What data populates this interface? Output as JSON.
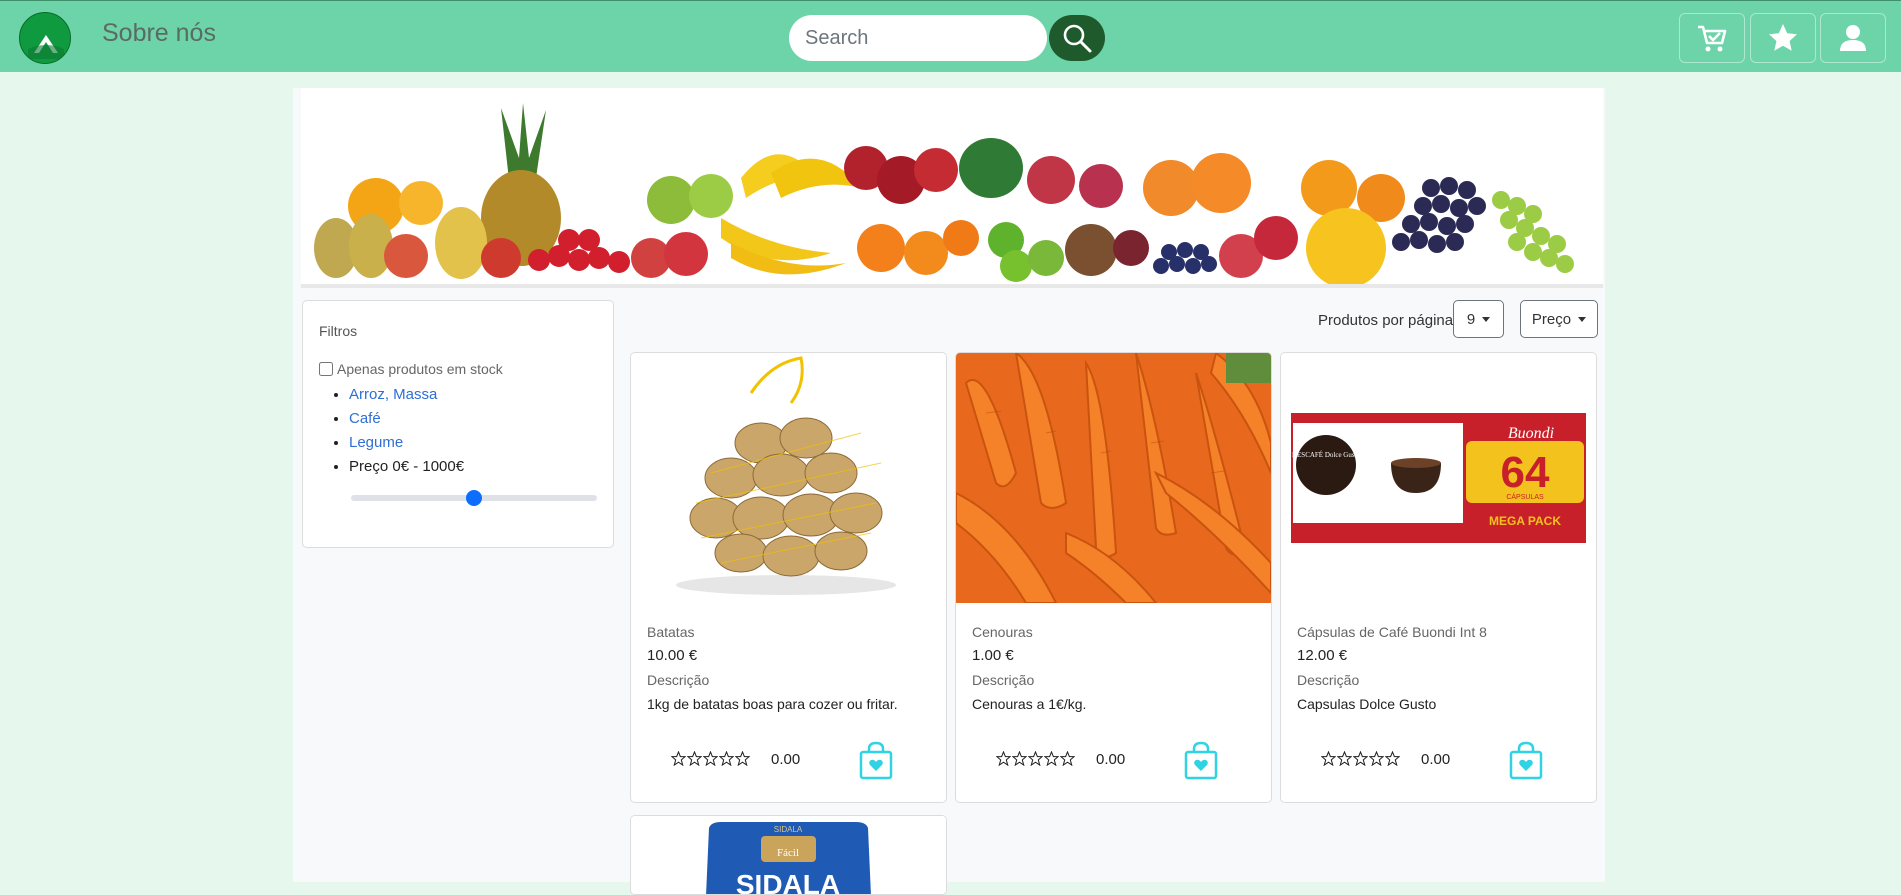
{
  "nav": {
    "about_label": "Sobre nós",
    "search_placeholder": "Search"
  },
  "filters": {
    "title": "Filtros",
    "stock_label": "Apenas produtos em stock",
    "categories": [
      "Arroz, Massa",
      "Café",
      "Legume"
    ],
    "price_label": "Preço 0€ - 1000€",
    "price_slider_fraction": 0.5
  },
  "toolbar": {
    "per_page_label": "Produtos por página",
    "per_page_value": "9",
    "sort_label": "Preço"
  },
  "products": [
    {
      "name": "Batatas",
      "price": "10.00 €",
      "desc_label": "Descrição",
      "desc": "1kg de batatas boas para cozer ou fritar.",
      "rating": "0.00"
    },
    {
      "name": "Cenouras",
      "price": "1.00 €",
      "desc_label": "Descrição",
      "desc": "Cenouras a 1€/kg.",
      "rating": "0.00"
    },
    {
      "name": "Cápsulas de Café Buondi Int 8",
      "price": "12.00 €",
      "desc_label": "Descrição",
      "desc": "Capsulas Dolce Gusto",
      "rating": "0.00",
      "image_text": {
        "brand": "NESCAFÉ Dolce Gusto",
        "brand2": "Buondi",
        "count": "64",
        "count_unit": "CÁPSULAS",
        "pack": "MEGA PACK"
      }
    },
    {
      "partial_image_text": {
        "brand": "SIDALA",
        "tag": "Fácil",
        "name": "SIDALA"
      }
    }
  ],
  "colors": {
    "navbar": "#6cd4a8",
    "accent": "#0d6efd",
    "bag_icon": "#2fd3e3"
  }
}
